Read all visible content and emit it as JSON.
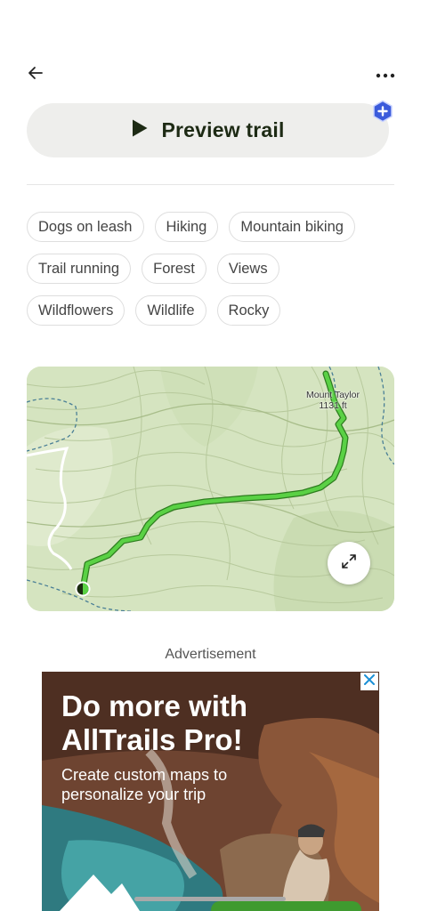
{
  "header": {
    "back_icon": "arrow-left-icon",
    "more_icon": "more-horizontal-icon"
  },
  "preview": {
    "label": "Preview trail",
    "icon": "play-icon",
    "badge_icon": "pro-plus-badge-icon",
    "badge_color": "#3b5bdb"
  },
  "tags": [
    [
      "Dogs on leash",
      "Hiking",
      "Mountain biking"
    ],
    [
      "Trail running",
      "Forest",
      "Views"
    ],
    [
      "Wildflowers",
      "Wildlife",
      "Rocky"
    ]
  ],
  "map": {
    "peak_name": "Mount Taylor",
    "peak_elevation": "1131 ft",
    "trail_color": "#5ad145",
    "expand_icon": "expand-icon"
  },
  "ad": {
    "label": "Advertisement",
    "title": "Do more with AllTrails Pro!",
    "subtitle": "Create custom maps to personalize your trip",
    "close_icon": "close-x-icon"
  }
}
